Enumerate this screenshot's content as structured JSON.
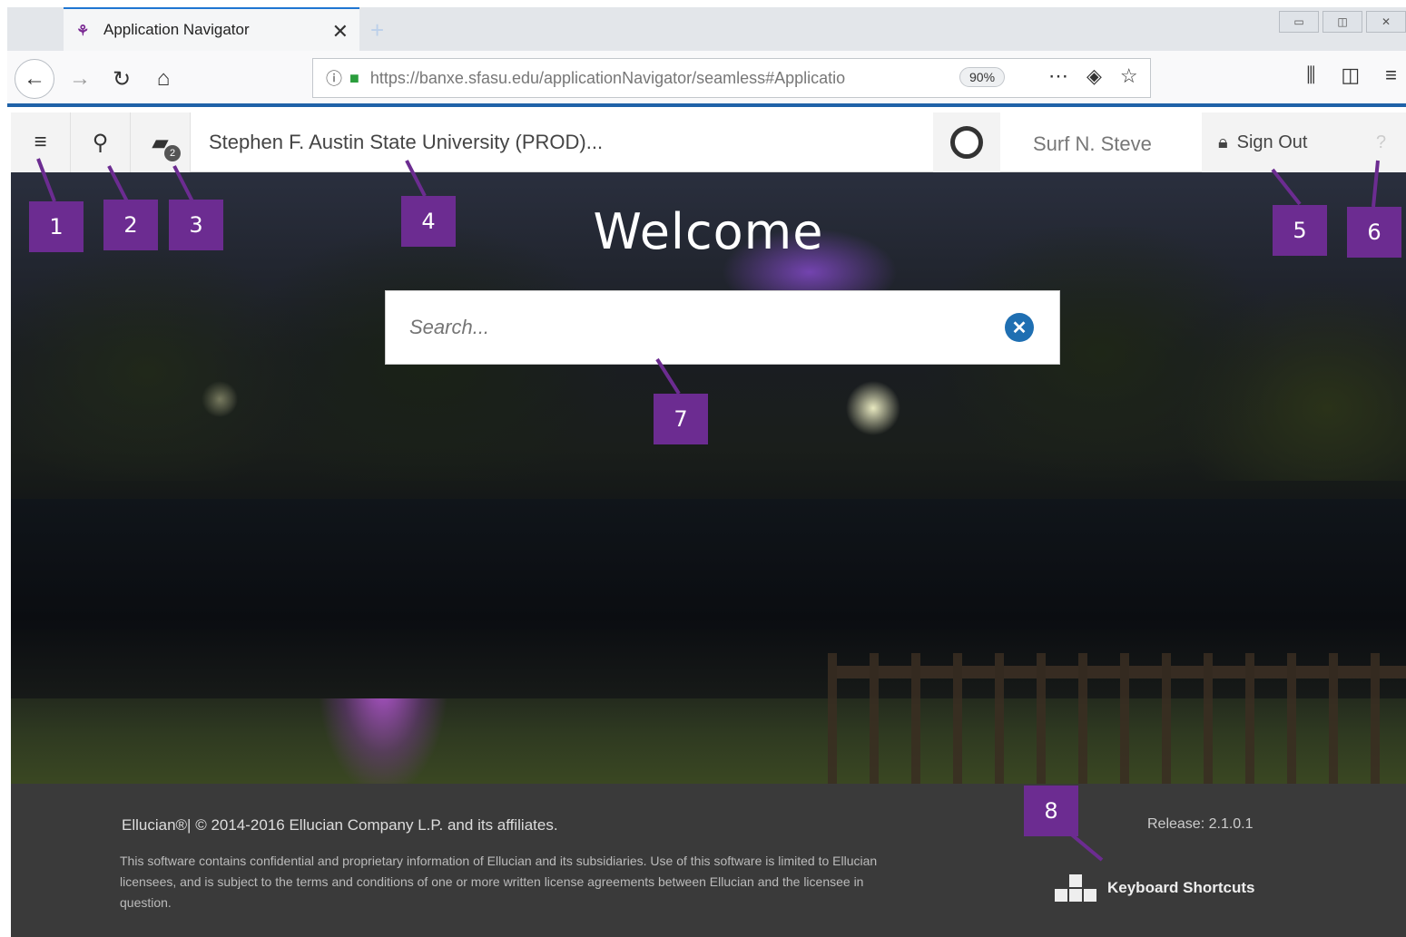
{
  "browser": {
    "tab_title": "Application Navigator",
    "url": "https://banxe.sfasu.edu/applicationNavigator/seamless#Applicatio",
    "zoom": "90%"
  },
  "header": {
    "institution": "Stephen F. Austin State University (PROD)...",
    "recent_count": "2",
    "username": "Surf N. Steve",
    "sign_out": "Sign Out",
    "help": "?"
  },
  "main": {
    "welcome": "Welcome",
    "search_placeholder": "Search..."
  },
  "footer": {
    "copyright": "Ellucian®| © 2014-2016 Ellucian Company L.P. and its affiliates.",
    "legal": "This software contains confidential and proprietary information of Ellucian and its subsidiaries. Use of this software is limited to Ellucian licensees, and is subject to the terms and conditions of one or more written license agreements between Ellucian and the licensee in question.",
    "release": "Release: 2.1.0.1",
    "keyboard_shortcuts": "Keyboard Shortcuts"
  },
  "annotations": [
    "1",
    "2",
    "3",
    "4",
    "5",
    "6",
    "7",
    "8"
  ],
  "colors": {
    "marker": "#6c2c91",
    "footer_bg": "#3a3a3a",
    "clear_button": "#1f6fb2"
  }
}
